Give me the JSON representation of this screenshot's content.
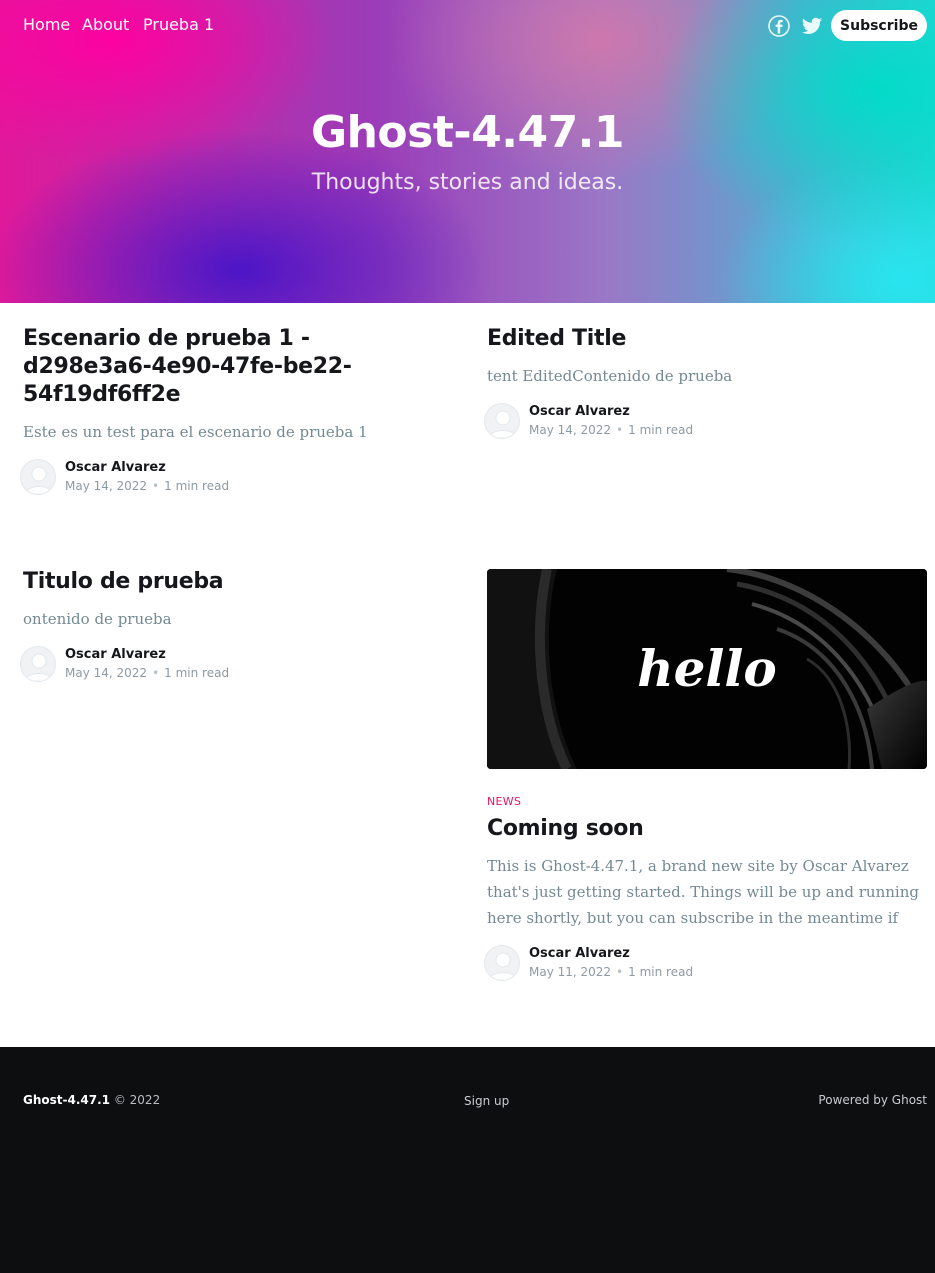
{
  "site": {
    "title": "Ghost-4.47.1",
    "description": "Thoughts, stories and ideas."
  },
  "nav": {
    "items": [
      {
        "label": "Home"
      },
      {
        "label": "About"
      },
      {
        "label": "Prueba 1"
      }
    ],
    "social_icons": [
      "facebook-icon",
      "twitter-icon"
    ],
    "subscribe_label": "Subscribe"
  },
  "posts": [
    {
      "title": "Escenario de prueba 1 - d298e3a6-4e90-47fe-be22-54f19df6ff2e",
      "excerpt": "Este es un test para el escenario de prueba 1",
      "author": "Oscar Alvarez",
      "date": "May 14, 2022",
      "reading_time": "1 min read"
    },
    {
      "title": "Edited Title",
      "excerpt": "tent EditedContenido de prueba",
      "author": "Oscar Alvarez",
      "date": "May 14, 2022",
      "reading_time": "1 min read"
    },
    {
      "title": "Titulo de prueba",
      "excerpt": "ontenido de prueba",
      "author": "Oscar Alvarez",
      "date": "May 14, 2022",
      "reading_time": "1 min read"
    },
    {
      "image_text": "hello",
      "tag": "NEWS",
      "title": "Coming soon",
      "excerpt": "This is Ghost-4.47.1, a brand new site by Oscar Alvarez that's just getting started. Things will be up and running here shortly, but you can subscribe in the meantime if you'd like to stay up to date and…",
      "author": "Oscar Alvarez",
      "date": "May 11, 2022",
      "reading_time": "1 min read"
    }
  ],
  "footer": {
    "brand": "Ghost-4.47.1",
    "copyright": "© 2022",
    "signup_label": "Sign up",
    "powered_by": "Powered by Ghost"
  },
  "colors": {
    "accent": "#e3156a",
    "footer_bg": "#0d0e10",
    "excerpt": "#738a94"
  }
}
